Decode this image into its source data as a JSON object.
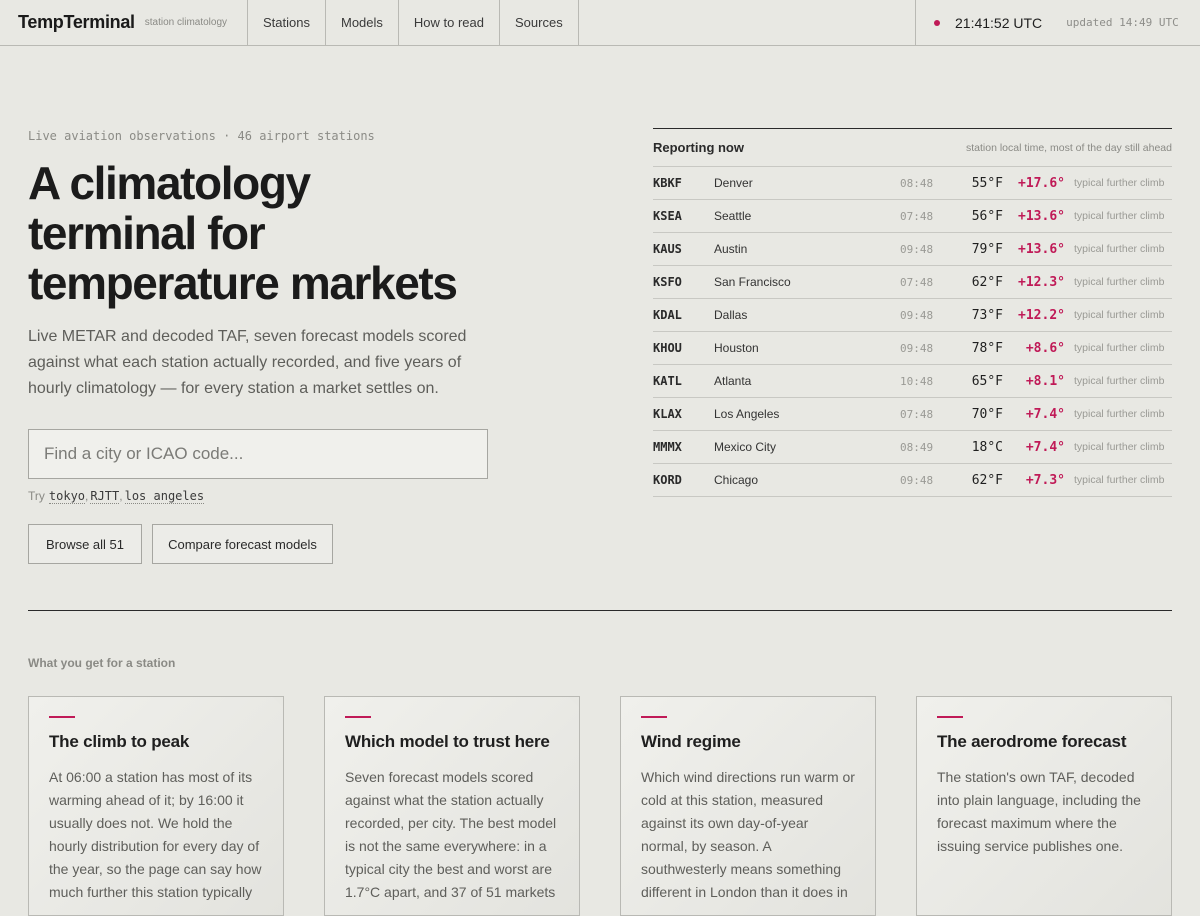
{
  "header": {
    "brand": "TempTerminal",
    "brand_sub": "station climatology",
    "nav": [
      "Stations",
      "Models",
      "How to read",
      "Sources"
    ],
    "clock": "21:41:52 UTC",
    "updated": "updated 14:49 UTC",
    "status_color": "#c01a57"
  },
  "hero": {
    "kicker": "Live aviation observations · 46 airport stations",
    "headline": "A climatology terminal for temperature markets",
    "lede": "Live METAR and decoded TAF, seven forecast models scored against what each station actually recorded, and five years of hourly climatology — for every station a market settles on.",
    "search_placeholder": "Find a city or ICAO code...",
    "try_label": "Try",
    "try_links": [
      "tokyo",
      "RJTT",
      "los angeles"
    ],
    "buttons": [
      "Browse all 51",
      "Compare forecast models"
    ]
  },
  "reporting": {
    "title": "Reporting now",
    "note": "station local time, most of the day still ahead",
    "rows": [
      {
        "code": "KBKF",
        "city": "Denver",
        "time": "08:48",
        "temp": "55°F",
        "delta": "+17.6°",
        "label": "typical further climb"
      },
      {
        "code": "KSEA",
        "city": "Seattle",
        "time": "07:48",
        "temp": "56°F",
        "delta": "+13.6°",
        "label": "typical further climb"
      },
      {
        "code": "KAUS",
        "city": "Austin",
        "time": "09:48",
        "temp": "79°F",
        "delta": "+13.6°",
        "label": "typical further climb"
      },
      {
        "code": "KSFO",
        "city": "San Francisco",
        "time": "07:48",
        "temp": "62°F",
        "delta": "+12.3°",
        "label": "typical further climb"
      },
      {
        "code": "KDAL",
        "city": "Dallas",
        "time": "09:48",
        "temp": "73°F",
        "delta": "+12.2°",
        "label": "typical further climb"
      },
      {
        "code": "KHOU",
        "city": "Houston",
        "time": "09:48",
        "temp": "78°F",
        "delta": "+8.6°",
        "label": "typical further climb"
      },
      {
        "code": "KATL",
        "city": "Atlanta",
        "time": "10:48",
        "temp": "65°F",
        "delta": "+8.1°",
        "label": "typical further climb"
      },
      {
        "code": "KLAX",
        "city": "Los Angeles",
        "time": "07:48",
        "temp": "70°F",
        "delta": "+7.4°",
        "label": "typical further climb"
      },
      {
        "code": "MMMX",
        "city": "Mexico City",
        "time": "08:49",
        "temp": "18°C",
        "delta": "+7.4°",
        "label": "typical further climb"
      },
      {
        "code": "KORD",
        "city": "Chicago",
        "time": "09:48",
        "temp": "62°F",
        "delta": "+7.3°",
        "label": "typical further climb"
      }
    ]
  },
  "features": {
    "title": "What you get for a station",
    "cards": [
      {
        "title": "The climb to peak",
        "body": "At 06:00 a station has most of its warming ahead of it; by 16:00 it usually does not. We hold the hourly distribution for every day of the year, so the page can say how much further this station typically"
      },
      {
        "title": "Which model to trust here",
        "body": "Seven forecast models scored against what the station actually recorded, per city. The best model is not the same everywhere: in a typical city the best and worst are 1.7°C apart, and 37 of 51 markets"
      },
      {
        "title": "Wind regime",
        "body": "Which wind directions run warm or cold at this station, measured against its own day-of-year normal, by season. A southwesterly means something different in London than it does in"
      },
      {
        "title": "The aerodrome forecast",
        "body": "The station's own TAF, decoded into plain language, including the forecast maximum where the issuing service publishes one."
      }
    ]
  }
}
